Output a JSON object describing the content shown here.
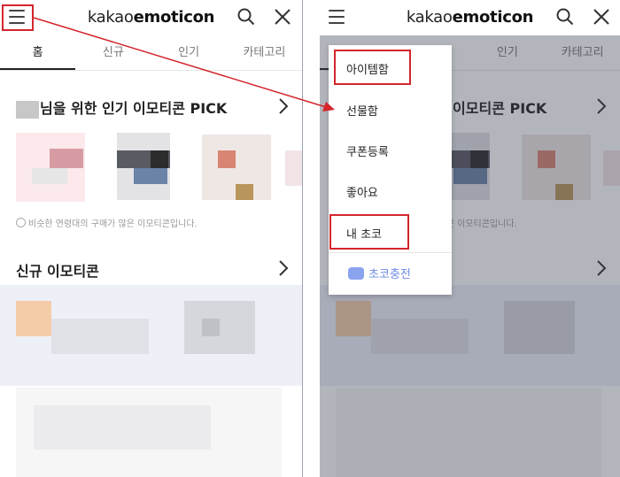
{
  "app": {
    "brand_light": "kakao",
    "brand_bold": "emoticon"
  },
  "tabs": [
    {
      "label": "홈",
      "active": true
    },
    {
      "label": "신규",
      "active": false
    },
    {
      "label": "인기",
      "active": false
    },
    {
      "label": "카테고리",
      "active": false
    }
  ],
  "sections": {
    "pick_title": "님을 위한 인기 이모티콘 PICK",
    "pick_note": "비슷한 연령대의 구매가 많은 이모티콘입니다.",
    "new_title": "신규 이모티콘"
  },
  "menu": {
    "items": [
      "아이템함",
      "선물함",
      "쿠폰등록",
      "좋아요",
      "내 초코"
    ],
    "charge_label": "초코충전"
  },
  "icons": [
    "menu-icon",
    "search-icon",
    "close-icon",
    "chevron-right-icon",
    "info-icon",
    "piggy-bank-icon"
  ],
  "colors": {
    "highlight": "#d4262c",
    "charge": "#6d8ae6"
  }
}
